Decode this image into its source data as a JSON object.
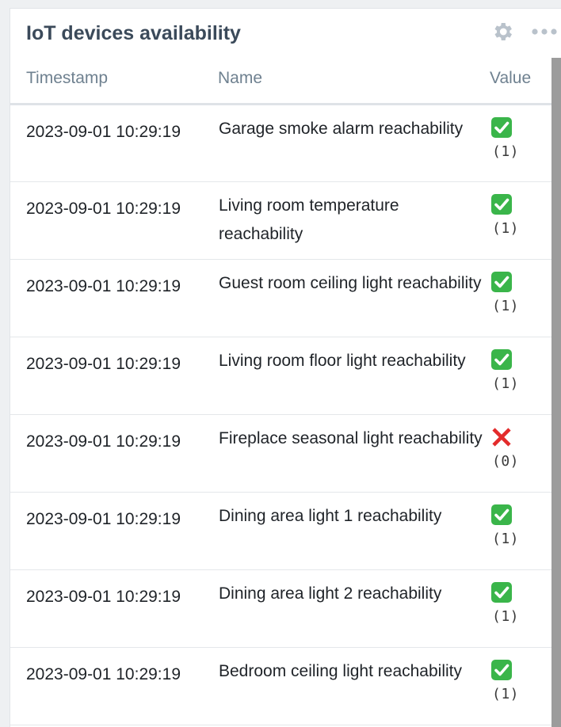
{
  "widget": {
    "title": "IoT devices availability",
    "settings_icon": "gear-icon",
    "menu_icon": "more-dots-icon"
  },
  "columns": {
    "timestamp": "Timestamp",
    "name": "Name",
    "value": "Value"
  },
  "rows": [
    {
      "timestamp": "2023-09-01 10:29:19",
      "name": "Garage smoke alarm reachability",
      "status": "ok",
      "raw": "(1)"
    },
    {
      "timestamp": "2023-09-01 10:29:19",
      "name": "Living room temperature reachability",
      "status": "ok",
      "raw": "(1)"
    },
    {
      "timestamp": "2023-09-01 10:29:19",
      "name": "Guest room ceiling light reachability",
      "status": "ok",
      "raw": "(1)"
    },
    {
      "timestamp": "2023-09-01 10:29:19",
      "name": "Living room floor light reachability",
      "status": "ok",
      "raw": "(1)"
    },
    {
      "timestamp": "2023-09-01 10:29:19",
      "name": "Fireplace seasonal light reachability",
      "status": "fail",
      "raw": "(0)"
    },
    {
      "timestamp": "2023-09-01 10:29:19",
      "name": "Dining area light 1 reachability",
      "status": "ok",
      "raw": "(1)"
    },
    {
      "timestamp": "2023-09-01 10:29:19",
      "name": "Dining area light 2 reachability",
      "status": "ok",
      "raw": "(1)"
    },
    {
      "timestamp": "2023-09-01 10:29:19",
      "name": "Bedroom ceiling light reachability",
      "status": "ok",
      "raw": "(1)"
    }
  ],
  "colors": {
    "ok": "#3ab54a",
    "fail": "#e32b2b",
    "title": "#3b4a5a",
    "header": "#6f8190"
  }
}
